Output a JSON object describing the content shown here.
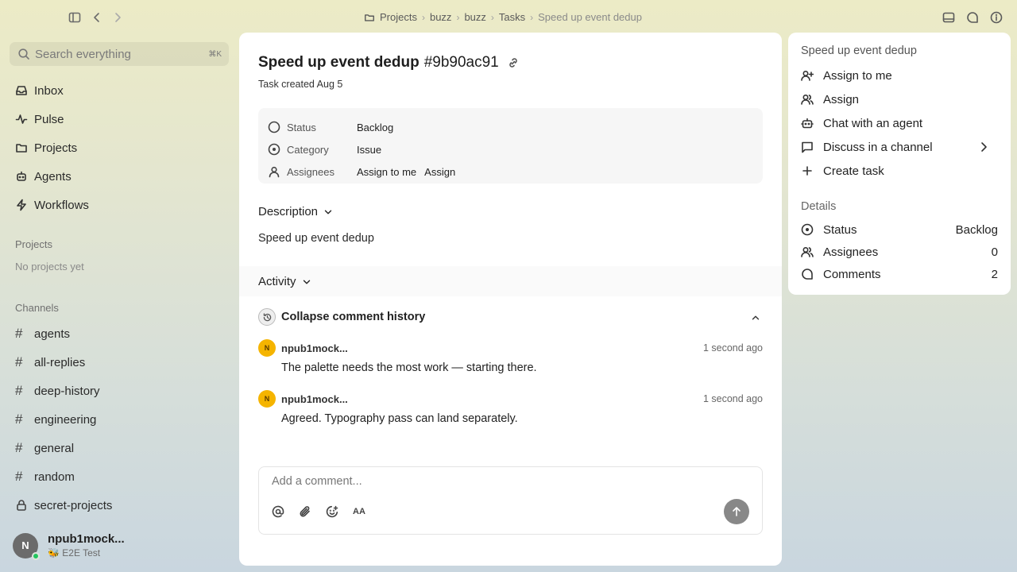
{
  "breadcrumbs": [
    "Projects",
    "buzz",
    "buzz",
    "Tasks",
    "Speed up event dedup"
  ],
  "sidebar": {
    "search_placeholder": "Search everything",
    "search_shortcut": "⌘K",
    "nav": [
      {
        "label": "Inbox",
        "icon": "inbox-icon"
      },
      {
        "label": "Pulse",
        "icon": "pulse-icon"
      },
      {
        "label": "Projects",
        "icon": "projects-icon"
      },
      {
        "label": "Agents",
        "icon": "agents-icon"
      },
      {
        "label": "Workflows",
        "icon": "workflows-icon"
      }
    ],
    "projects_title": "Projects",
    "projects_empty": "No projects yet",
    "channels_title": "Channels",
    "channels": [
      "agents",
      "all-replies",
      "deep-history",
      "engineering",
      "general",
      "random",
      "secret-projects"
    ],
    "user": {
      "initial": "N",
      "name": "npub1mock...",
      "status": "🐝 E2E Test"
    }
  },
  "task": {
    "title": "Speed up event dedup",
    "id": "#9b90ac91",
    "created": "Task created Aug 5",
    "properties": {
      "status_label": "Status",
      "status_value": "Backlog",
      "category_label": "Category",
      "category_value": "Issue",
      "assignees_label": "Assignees",
      "assign_me": "Assign to me",
      "assign": "Assign"
    },
    "description_heading": "Description",
    "description": "Speed up event dedup",
    "activity_heading": "Activity",
    "collapse_label": "Collapse comment history",
    "comments": [
      {
        "initial": "N",
        "author": "npub1mock...",
        "time": "1 second ago",
        "text": "The palette needs the most work — starting there."
      },
      {
        "initial": "N",
        "author": "npub1mock...",
        "time": "1 second ago",
        "text": "Agreed. Typography pass can land separately."
      }
    ],
    "composer_placeholder": "Add a comment...",
    "composer_aa": "AA"
  },
  "panel": {
    "title": "Speed up event dedup",
    "actions": [
      "Assign to me",
      "Assign",
      "Chat with an agent",
      "Discuss in a channel",
      "Create task"
    ],
    "details_title": "Details",
    "details": [
      {
        "label": "Status",
        "value": "Backlog"
      },
      {
        "label": "Assignees",
        "value": "0"
      },
      {
        "label": "Comments",
        "value": "2"
      }
    ]
  }
}
